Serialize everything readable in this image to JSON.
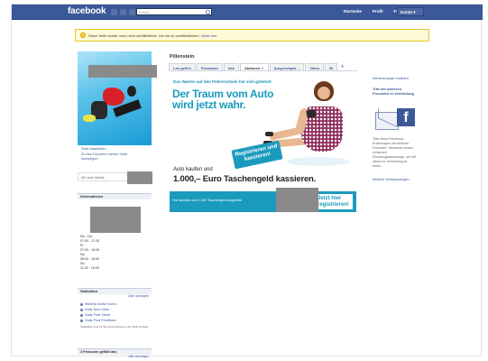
{
  "topbar": {
    "logo": "facebook",
    "search_placeholder": "Suche",
    "nav": [
      "Startseite",
      "Profil",
      "Freunde finden",
      "Konto ▾"
    ]
  },
  "notice": {
    "text": "Diese Seite wurde noch nicht veröffentlicht. Um sie zu veröffentlichen, ",
    "link": "klicke hier."
  },
  "page": {
    "name": "Pillenstein",
    "tabs": [
      "Los geht's",
      "Pinnwand",
      "Info",
      "Aktionen ✓",
      "Ausprechpar…",
      "Video",
      "Bi"
    ],
    "tab_plus": "+"
  },
  "left": {
    "edit_page": "Seite bearbeiten",
    "add_to_favorites": "Zu den Favoriten meiner Seite hinzufügen",
    "write_something": "Wir sind Vollzeit…",
    "info_header": "Informationen",
    "hours": [
      "Mo - Do:",
      "07:00 - 17:30",
      "Fr:",
      "07:00 - 16:00",
      "Sa:",
      "08:00 - 16:00",
      "So:",
      "11:00 - 16:00"
    ],
    "insights_header": "Statistiken",
    "insights_all": "Alle anzeigen",
    "insights_items": [
      "Monthly Active Users",
      "Daily New Likes",
      "Daily Post Views",
      "Daily Post Feedback"
    ],
    "insights_note": "Statistiken sind für Sie Administratoren der Seite sichtbar.",
    "likes_header": "4 Personen gefällt das",
    "likes_all": "Alle anzeigen"
  },
  "ad": {
    "intro": "Das Warten auf den Führerschein hat sich gelohnt!",
    "headline_line1": "Der Traum vom Auto",
    "headline_line2": "wird jetzt wahr.",
    "badge_line1": "Registrieren und",
    "badge_line2": "kassieren!",
    "sub": "Auto kaufen und",
    "amount": "1.000,– Euro Taschengeld kassieren.",
    "bar_text": "Fan werden und 1.000 Taschengeld abgreifen",
    "bar_button_line1": "Jetzt hier",
    "bar_button_line2": "registrieren!"
  },
  "right": {
    "create_ad": "Werbeanzeige erstellen",
    "invite_title": "Tritt mit weiteren Freunden in Verbindung",
    "invite_desc": "Teile deine Facebook-Erfahrungen mit weiteren Freunden. Verwende unsere einfachen Einladungswerkzeuge, um mit diesen in Verbindung zu treten.",
    "more_ads": "Weitere Werbeanzeigen"
  },
  "colors": {
    "facebook_blue": "#3b5998",
    "ad_teal": "#1a9bbd",
    "notice_bg": "#fff9d7"
  }
}
